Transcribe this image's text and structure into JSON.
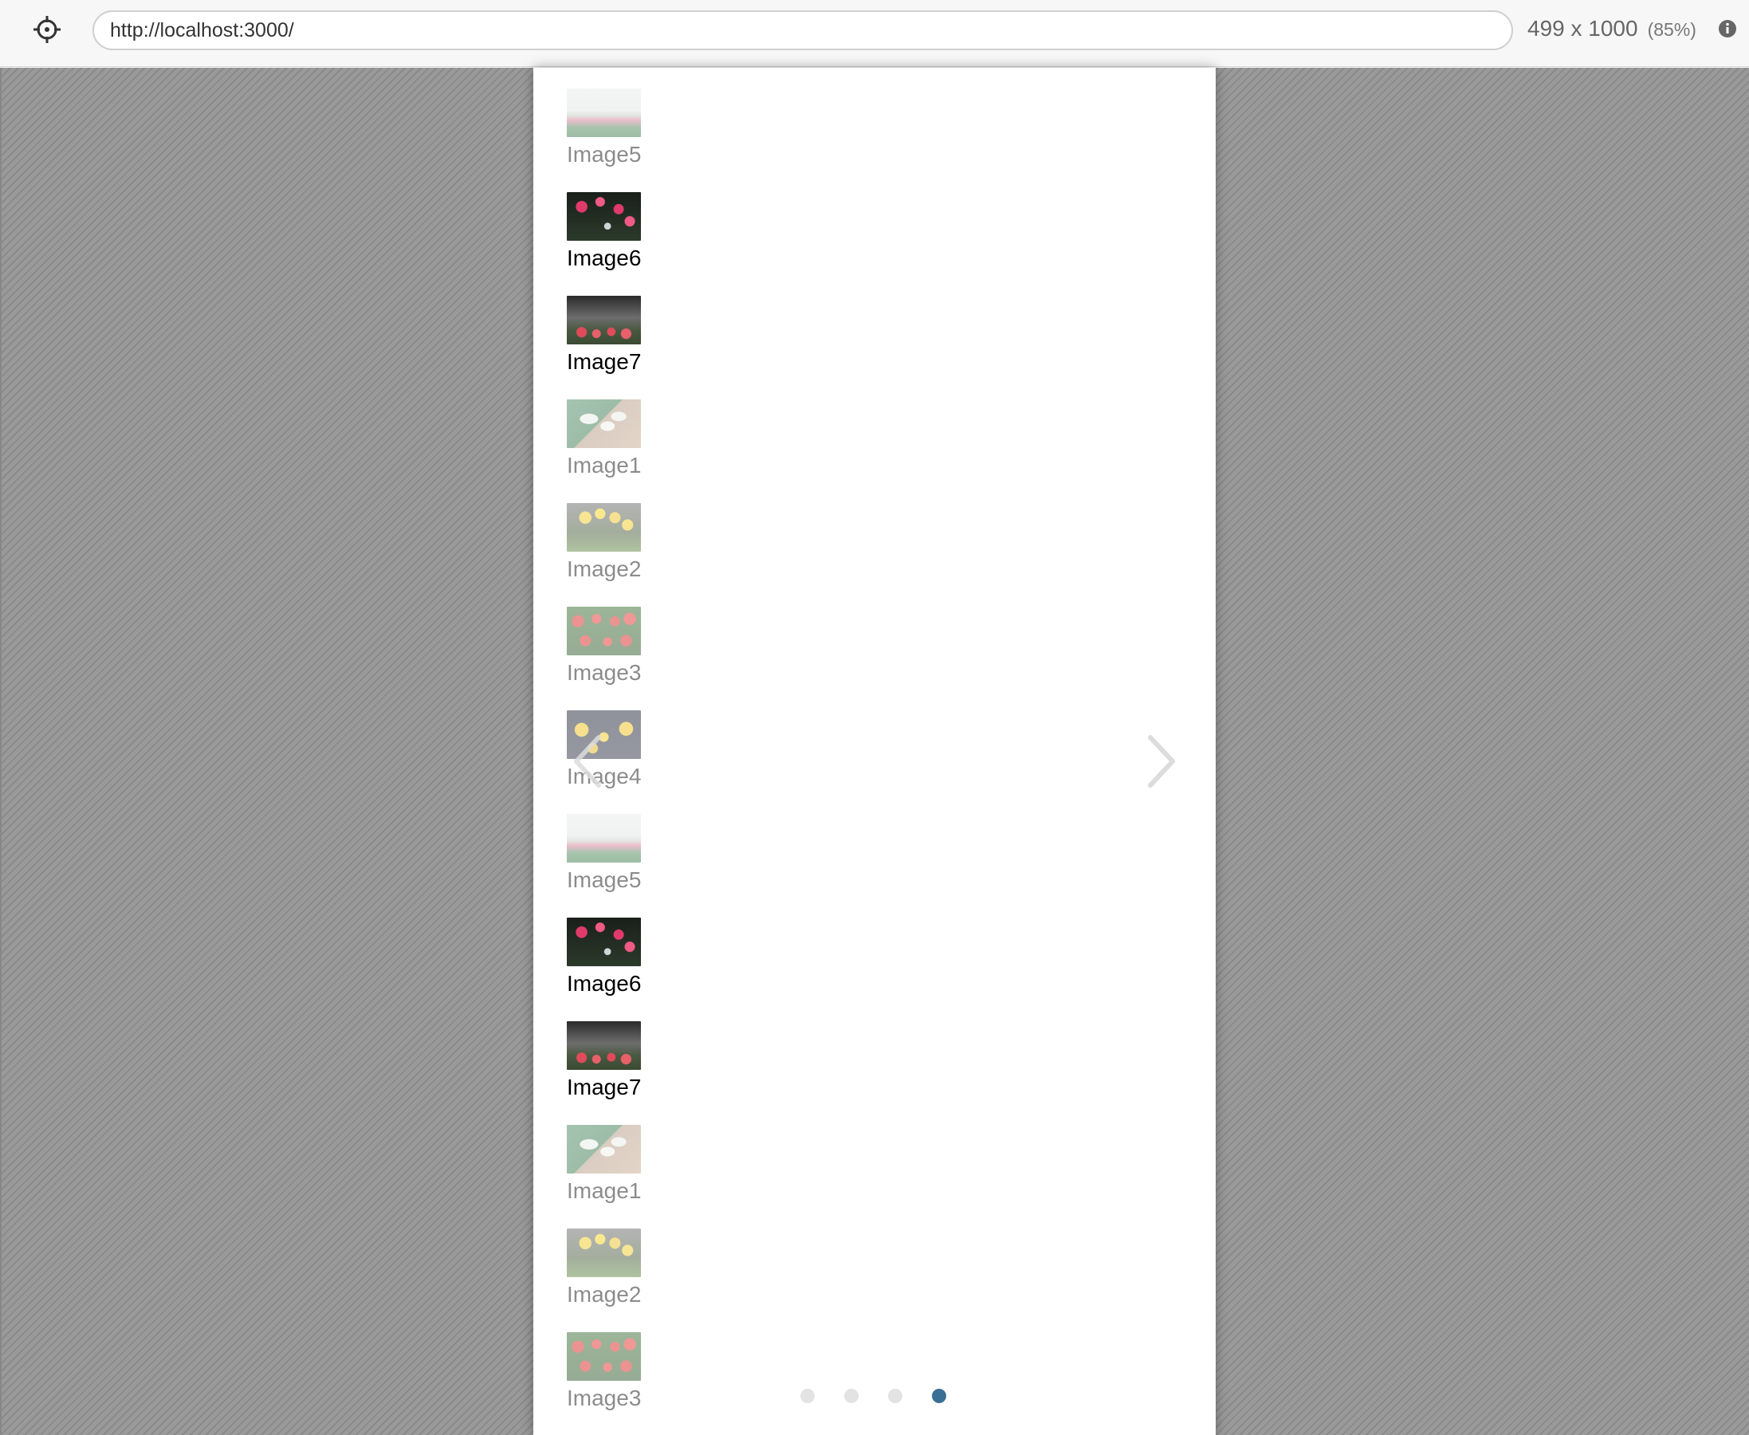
{
  "toolbar": {
    "url": "http://localhost:3000/",
    "dimensions": "499 x 1000",
    "zoom": "(85%)",
    "target_icon": "crosshair-icon",
    "info_icon": "info-icon"
  },
  "carousel": {
    "slides": [
      {
        "label": "Image5",
        "art": "t5",
        "dim": true
      },
      {
        "label": "Image6",
        "art": "t6",
        "dim": false
      },
      {
        "label": "Image7",
        "art": "t7",
        "dim": false
      },
      {
        "label": "Image1",
        "art": "t1",
        "dim": true
      },
      {
        "label": "Image2",
        "art": "t2",
        "dim": true
      },
      {
        "label": "Image3",
        "art": "t3",
        "dim": true
      },
      {
        "label": "Image4",
        "art": "t4",
        "dim": true
      },
      {
        "label": "Image5",
        "art": "t5",
        "dim": true
      },
      {
        "label": "Image6",
        "art": "t6",
        "dim": false
      },
      {
        "label": "Image7",
        "art": "t7",
        "dim": false
      },
      {
        "label": "Image1",
        "art": "t1",
        "dim": true
      },
      {
        "label": "Image2",
        "art": "t2",
        "dim": true
      },
      {
        "label": "Image3",
        "art": "t3",
        "dim": true
      }
    ],
    "prev_icon": "chevron-left-icon",
    "next_icon": "chevron-right-icon",
    "dots": [
      {
        "active": false
      },
      {
        "active": false
      },
      {
        "active": false
      },
      {
        "active": true
      }
    ],
    "accent_color": "#3a6f95",
    "dot_color": "#e3e3e3"
  }
}
